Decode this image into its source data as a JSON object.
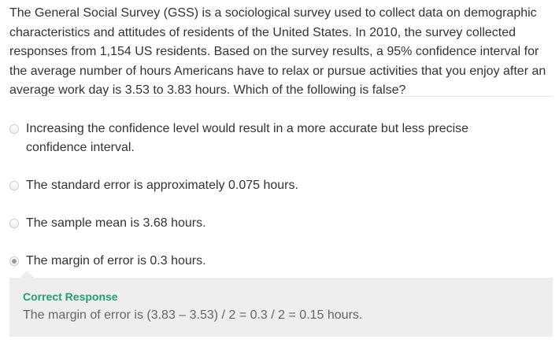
{
  "question": {
    "text": "The General Social Survey (GSS) is a sociological survey used to collect data on demographic characteristics and attitudes of residents of the United States. In 2010, the survey collected responses from 1,154 US residents. Based on the survey results, a 95% confidence interval for the average number of hours Americans have to relax or pursue activities that you enjoy after an average work day is 3.53 to 3.83 hours. Which of the following is false?"
  },
  "options": [
    {
      "label": "Increasing the confidence level would result in a more accurate but less precise confidence interval.",
      "selected": false
    },
    {
      "label": "The standard error is approximately 0.075 hours.",
      "selected": false
    },
    {
      "label": "The sample mean is 3.68 hours.",
      "selected": false
    },
    {
      "label": "The margin of error is 0.3 hours.",
      "selected": true
    }
  ],
  "feedback": {
    "title": "Correct Response",
    "text": "The margin of error is (3.83 – 3.53) / 2 = 0.3 / 2 = 0.15 hours.",
    "title_color": "#22a06b"
  }
}
